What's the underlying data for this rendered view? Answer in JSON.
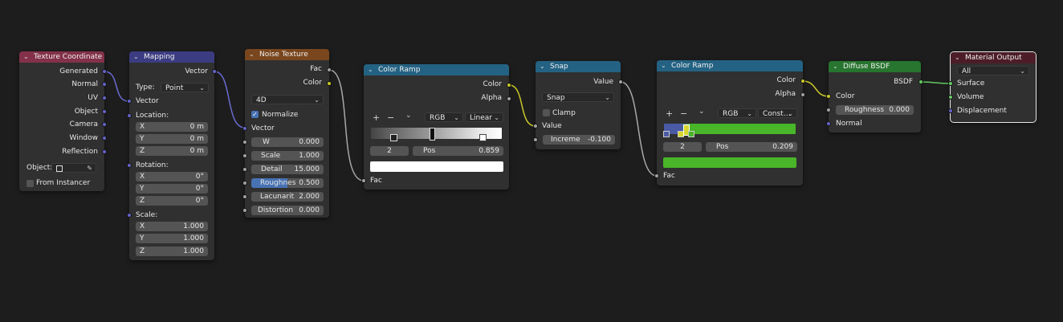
{
  "texture_coordinate": {
    "title": "Texture Coordinate",
    "outputs": [
      "Generated",
      "Normal",
      "UV",
      "Object",
      "Camera",
      "Window",
      "Reflection"
    ],
    "object_label": "Object:",
    "from_instancer": "From Instancer"
  },
  "mapping": {
    "title": "Mapping",
    "output": "Vector",
    "type_label": "Type:",
    "type_value": "Point",
    "vector_label": "Vector",
    "location_label": "Location:",
    "location": [
      {
        "axis": "X",
        "value": "0 m"
      },
      {
        "axis": "Y",
        "value": "0 m"
      },
      {
        "axis": "Z",
        "value": "0 m"
      }
    ],
    "rotation_label": "Rotation:",
    "rotation": [
      {
        "axis": "X",
        "value": "0°"
      },
      {
        "axis": "Y",
        "value": "0°"
      },
      {
        "axis": "Z",
        "value": "0°"
      }
    ],
    "scale_label": "Scale:",
    "scale": [
      {
        "axis": "X",
        "value": "1.000"
      },
      {
        "axis": "Y",
        "value": "1.000"
      },
      {
        "axis": "Z",
        "value": "1.000"
      }
    ]
  },
  "noise_texture": {
    "title": "Noise Texture",
    "outputs": [
      "Fac",
      "Color"
    ],
    "dimensions": "4D",
    "normalize": "Normalize",
    "vector_label": "Vector",
    "params": [
      {
        "label": "W",
        "value": "0.000"
      },
      {
        "label": "Scale",
        "value": "1.000"
      },
      {
        "label": "Detail",
        "value": "15.000"
      },
      {
        "label": "Roughnes",
        "value": "0.500"
      },
      {
        "label": "Lacunarit",
        "value": "2.000"
      },
      {
        "label": "Distortion",
        "value": "0.000"
      }
    ]
  },
  "color_ramp_1": {
    "title": "Color Ramp",
    "outputs": [
      "Color",
      "Alpha"
    ],
    "color_mode": "RGB",
    "interpolation": "Linear",
    "index": "2",
    "pos_label": "Pos",
    "pos_value": "0.859",
    "input": "Fac"
  },
  "snap": {
    "title": "Snap",
    "output": "Value",
    "operation": "Snap",
    "clamp": "Clamp",
    "value_label": "Value",
    "increment_label": "Increme",
    "increment_value": "-0.100"
  },
  "color_ramp_2": {
    "title": "Color Ramp",
    "outputs": [
      "Color",
      "Alpha"
    ],
    "color_mode": "RGB",
    "interpolation": "Const…",
    "index": "2",
    "pos_label": "Pos",
    "pos_value": "0.209",
    "input": "Fac"
  },
  "diffuse_bsdf": {
    "title": "Diffuse BSDF",
    "output": "BSDF",
    "color_label": "Color",
    "roughness_label": "Roughness",
    "roughness_value": "0.000",
    "normal_label": "Normal"
  },
  "material_output": {
    "title": "Material Output",
    "target": "All",
    "inputs": [
      "Surface",
      "Volume",
      "Displacement"
    ]
  },
  "colors": {
    "input_header": "#83314a",
    "vector_header": "#3c3c83",
    "texture_header": "#79461d",
    "converter_header": "#246283",
    "shader_header": "#27752f",
    "output_header": "#4c1d28",
    "ramp2_green": "#49b529"
  }
}
